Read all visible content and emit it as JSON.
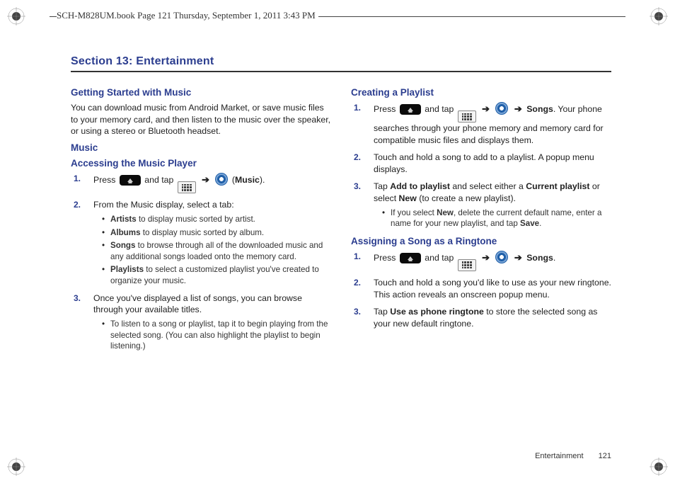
{
  "header": "SCH-M828UM.book  Page 121  Thursday, September 1, 2011  3:43 PM",
  "section_title": "Section 13: Entertainment",
  "left": {
    "h_getting_started": "Getting Started with Music",
    "p_getting_started": "You can download music from Android Market, or save music files to your memory card, and then listen to the music over the speaker, or using a stereo or Bluetooth headset.",
    "h_music": "Music",
    "h_accessing": "Accessing the Music Player",
    "step1_a": "Press ",
    "step1_b": " and tap ",
    "arrow": "➔",
    "music_label": "Music",
    "step2": "From the Music display, select a tab:",
    "tabs": {
      "artists_b": "Artists",
      "artists_t": " to display music sorted by artist.",
      "albums_b": "Albums",
      "albums_t": " to display music sorted by album.",
      "songs_b": "Songs",
      "songs_t": " to browse through all of the downloaded music and any additional songs loaded onto the memory card.",
      "playlists_b": "Playlists",
      "playlists_t": " to select a customized playlist you've created to organize your music."
    },
    "step3": "Once you've displayed a list of songs, you can browse through your available titles.",
    "step3_sub": "To listen to a song or playlist, tap it to begin playing from the selected song. (You can also highlight the playlist to begin listening.)"
  },
  "right": {
    "h_creating": "Creating a Playlist",
    "cp1_a": "Press ",
    "cp1_b": " and tap ",
    "arrow": "➔",
    "songs_b": "Songs",
    "cp1_c": ". Your phone searches through your phone memory and memory card for compatible music files and displays them.",
    "cp2": "Touch and hold a song to add to a playlist. A popup menu displays.",
    "cp3_a": "Tap ",
    "cp3_b": "Add to playlist",
    "cp3_c": " and select either a ",
    "cp3_d": "Current playlist",
    "cp3_e": " or select ",
    "cp3_f": "New",
    "cp3_g": " (to create a new playlist).",
    "cp3_sub_a": "If you select ",
    "cp3_sub_b": "New",
    "cp3_sub_c": ", delete the current default name, enter a name for your new playlist, and tap ",
    "cp3_sub_d": "Save",
    "cp3_sub_e": ".",
    "h_assigning": "Assigning a Song as a Ringtone",
    "as1_a": "Press ",
    "as1_b": " and tap ",
    "as1_c": ".",
    "as2": "Touch and hold a song you'd like to use as your new ringtone. This action reveals an onscreen popup menu.",
    "as3_a": "Tap ",
    "as3_b": "Use as phone ringtone",
    "as3_c": " to store the selected song as your new default ringtone."
  },
  "footer": {
    "section": "Entertainment",
    "page": "121"
  },
  "nums": {
    "n1": "1.",
    "n2": "2.",
    "n3": "3."
  }
}
